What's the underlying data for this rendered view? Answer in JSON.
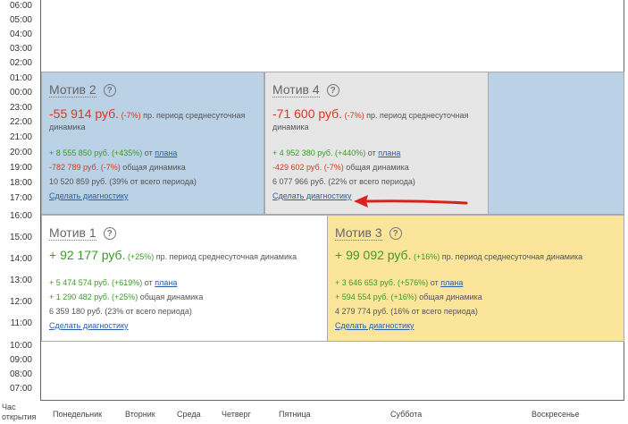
{
  "hours": [
    "06:00",
    "05:00",
    "04:00",
    "03:00",
    "02:00",
    "01:00",
    "00:00",
    "23:00",
    "22:00",
    "21:00",
    "20:00",
    "19:00",
    "18:00",
    "17:00",
    "16:00",
    "15:00",
    "14:00",
    "13:00",
    "12:00",
    "11:00",
    "10:00",
    "09:00",
    "08:00",
    "07:00"
  ],
  "corner_label_1": "Час",
  "corner_label_2": "открытия",
  "days": [
    "Понедельник",
    "Вторник",
    "Среда",
    "Четверг",
    "Пятница",
    "Суббота",
    "Воскресенье"
  ],
  "help_symbol": "?",
  "motives": {
    "m2": {
      "title": "Мотив 2",
      "amount": "-55 914 руб.",
      "pct": "(-7%)",
      "desc": "пр. период среднесуточная динамика",
      "plan_amount": "+ 8 555 850 руб.",
      "plan_pct": "(+435%)",
      "plan_from": "от",
      "plan_link": "плана",
      "dyn_amount": "-782 789 руб.",
      "dyn_pct": "(-7%)",
      "dyn_text": "общая динамика",
      "total": "10 520 859 руб. (39% от всего периода)",
      "diag": "Сделать диагностику"
    },
    "m4": {
      "title": "Мотив 4",
      "amount": "-71 600 руб.",
      "pct": "(-7%)",
      "desc": "пр. период среднесуточная динамика",
      "plan_amount": "+ 4 952 380 руб.",
      "plan_pct": "(+440%)",
      "plan_from": "от",
      "plan_link": "плана",
      "dyn_amount": "-429 602 руб.",
      "dyn_pct": "(-7%)",
      "dyn_text": "общая динамика",
      "total": "6 077 966 руб. (22% от всего периода)",
      "diag": "Сделать диагностику"
    },
    "m1": {
      "title": "Мотив 1",
      "amount": "+ 92 177 руб.",
      "pct": "(+25%)",
      "desc": "пр. период среднесуточная динамика",
      "plan_amount": "+ 5 474 574 руб.",
      "plan_pct": "(+619%)",
      "plan_from": "от",
      "plan_link": "плана",
      "dyn_amount": "+ 1 290 482 руб.",
      "dyn_pct": "(+25%)",
      "dyn_text": "общая динамика",
      "total": "6 359 180 руб. (23% от всего периода)",
      "diag": "Сделать диагностику"
    },
    "m3": {
      "title": "Мотив 3",
      "amount": "+ 99 092 руб.",
      "pct": "(+16%)",
      "desc": "пр. период среднесуточная динамика",
      "plan_amount": "+ 3 646 653 руб.",
      "plan_pct": "(+576%)",
      "plan_from": "от",
      "plan_link": "плана",
      "dyn_amount": "+ 594 554 руб.",
      "dyn_pct": "(+16%)",
      "dyn_text": "общая динамика",
      "total": "4 279 774 руб. (16% от всего периода)",
      "diag": "Сделать диагностику"
    }
  },
  "colors": {
    "negative": "#d9391f",
    "positive": "#3c9a2a",
    "link": "#2a5da8",
    "block_blue": "#bad1e6",
    "block_grey": "#e6e6e6",
    "block_yellow": "#fbe59b",
    "arrow": "#d9221a"
  }
}
